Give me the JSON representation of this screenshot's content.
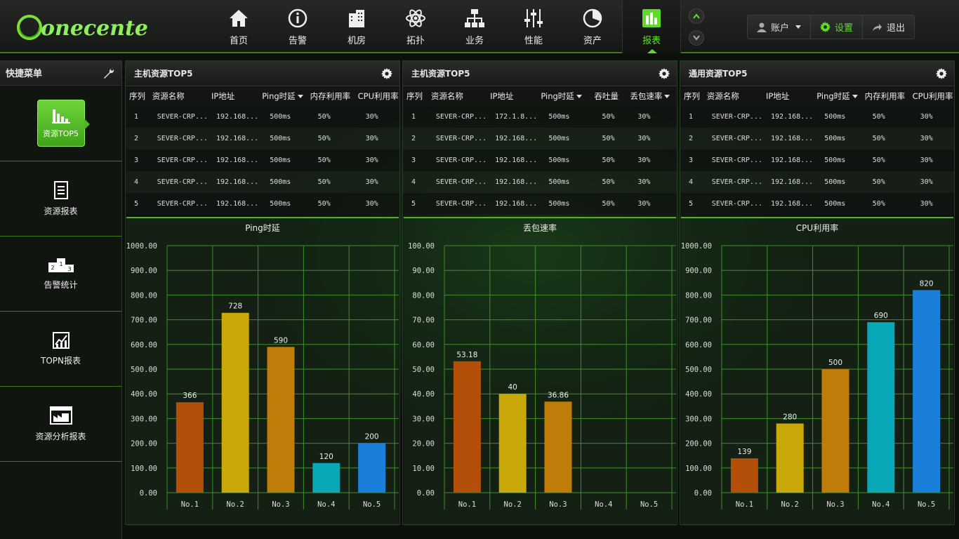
{
  "logo_text": "onecenter",
  "nav": [
    {
      "label": "首页",
      "icon": "home-icon"
    },
    {
      "label": "告警",
      "icon": "info-icon"
    },
    {
      "label": "机房",
      "icon": "building-icon"
    },
    {
      "label": "拓扑",
      "icon": "atom-icon"
    },
    {
      "label": "业务",
      "icon": "hierarchy-icon"
    },
    {
      "label": "性能",
      "icon": "sliders-icon"
    },
    {
      "label": "资产",
      "icon": "pie-icon"
    },
    {
      "label": "报表",
      "icon": "bar-chart-icon",
      "active": true
    }
  ],
  "user": {
    "account": "账户",
    "settings": "设置",
    "logout": "退出"
  },
  "sidebar": {
    "title": "快捷菜单",
    "items": [
      {
        "label": "资源TOP5",
        "icon": "bar-chart-icon"
      },
      {
        "label": "资源报表",
        "icon": "document-icon"
      },
      {
        "label": "告警统计",
        "icon": "podium-icon"
      },
      {
        "label": "TOPN报表",
        "icon": "line-chart-icon"
      },
      {
        "label": "资源分析报表",
        "icon": "factory-icon"
      }
    ]
  },
  "panels": [
    {
      "title": "主机资源TOP5",
      "columns": [
        "序列",
        "资源名称",
        "IP地址",
        "Ping时延",
        "内存利用率",
        "CPU利用率"
      ],
      "rows": [
        [
          "1",
          "SEVER-CRP...",
          "192.168...",
          "500ms",
          "50%",
          "30%"
        ],
        [
          "2",
          "SEVER-CRP...",
          "192.168...",
          "500ms",
          "50%",
          "30%"
        ],
        [
          "3",
          "SEVER-CRP...",
          "192.168...",
          "500ms",
          "50%",
          "30%"
        ],
        [
          "4",
          "SEVER-CRP...",
          "192.168...",
          "500ms",
          "50%",
          "30%"
        ],
        [
          "5",
          "SEVER-CRP...",
          "192.168...",
          "500ms",
          "50%",
          "30%"
        ]
      ]
    },
    {
      "title": "主机资源TOP5",
      "columns": [
        "序列",
        "资源名称",
        "IP地址",
        "Ping时延",
        "吞吐量",
        "丢包速率"
      ],
      "rows": [
        [
          "1",
          "SEVER-CRP...",
          "172.1.8...",
          "500ms",
          "50%",
          "30%"
        ],
        [
          "2",
          "SEVER-CRP...",
          "192.168...",
          "500ms",
          "50%",
          "30%"
        ],
        [
          "3",
          "SEVER-CRP...",
          "192.168...",
          "500ms",
          "50%",
          "30%"
        ],
        [
          "4",
          "SEVER-CRP...",
          "192.168...",
          "500ms",
          "50%",
          "30%"
        ],
        [
          "5",
          "SEVER-CRP...",
          "192.168...",
          "500ms",
          "50%",
          "30%"
        ]
      ]
    },
    {
      "title": "通用资源TOP5",
      "columns": [
        "序列",
        "资源名称",
        "IP地址",
        "Ping时延",
        "内存利用率",
        "CPU利用率"
      ],
      "rows": [
        [
          "1",
          "SEVER-CRP...",
          "192.168...",
          "500ms",
          "50%",
          "30%"
        ],
        [
          "2",
          "SEVER-CRP...",
          "192.168...",
          "500ms",
          "50%",
          "30%"
        ],
        [
          "3",
          "SEVER-CRP...",
          "192.168...",
          "500ms",
          "50%",
          "30%"
        ],
        [
          "4",
          "SEVER-CRP...",
          "192.168...",
          "500ms",
          "50%",
          "30%"
        ],
        [
          "5",
          "SEVER-CRP...",
          "192.168...",
          "500ms",
          "50%",
          "30%"
        ]
      ]
    }
  ],
  "chart_data": [
    {
      "type": "bar",
      "title": "Ping时延",
      "categories": [
        "No.1",
        "No.2",
        "No.3",
        "No.4",
        "No.5"
      ],
      "values": [
        366,
        728,
        590,
        120,
        200
      ],
      "labels": [
        "366",
        "728",
        "590",
        "120",
        "200"
      ],
      "colors": [
        "#b44f0a",
        "#c9a80a",
        "#c07c08",
        "#08a8b8",
        "#1a7fd8"
      ],
      "ylim": [
        0,
        1000
      ],
      "yticks": [
        "0.00",
        "100.00",
        "200.00",
        "300.00",
        "400.00",
        "500.00",
        "600.00",
        "700.00",
        "800.00",
        "900.00",
        "1000.00"
      ],
      "grid": true
    },
    {
      "type": "bar",
      "title": "丢包速率",
      "categories": [
        "No.1",
        "No.2",
        "No.3",
        "No.4",
        "No.5"
      ],
      "values": [
        53.18,
        40,
        36.86,
        null,
        null
      ],
      "labels": [
        "53.18",
        "40",
        "36.86",
        "",
        ""
      ],
      "colors": [
        "#b44f0a",
        "#c9a80a",
        "#c07c08",
        "#08a8b8",
        "#1a7fd8"
      ],
      "ylim": [
        0,
        100
      ],
      "yticks": [
        "0.00",
        "10.00",
        "20.00",
        "30.00",
        "40.00",
        "50.00",
        "60.00",
        "70.00",
        "80.00",
        "90.00",
        "100.00"
      ],
      "grid": true
    },
    {
      "type": "bar",
      "title": "CPU利用率",
      "categories": [
        "No.1",
        "No.2",
        "No.3",
        "No.4",
        "No.5"
      ],
      "values": [
        139,
        280,
        500,
        690,
        820
      ],
      "labels": [
        "139",
        "280",
        "500",
        "690",
        "820"
      ],
      "colors": [
        "#b44f0a",
        "#c9a80a",
        "#c07c08",
        "#08a8b8",
        "#1a7fd8"
      ],
      "ylim": [
        0,
        1000
      ],
      "yticks": [
        "0.00",
        "100.00",
        "200.00",
        "300.00",
        "400.00",
        "500.00",
        "600.00",
        "700.00",
        "800.00",
        "900.00",
        "1000.00"
      ],
      "grid": true
    }
  ],
  "colors": {
    "accent": "#5fdc2a",
    "grid": "#3f8f2a",
    "divider": "#3a7a1a"
  }
}
